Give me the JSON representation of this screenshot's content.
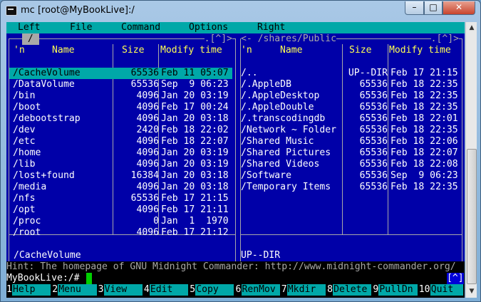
{
  "window": {
    "title": "mc [root@MyBookLive]:/",
    "minimize": "–",
    "maximize": "□",
    "close": "✕"
  },
  "menubar": [
    "Left",
    "File",
    "Command",
    "Options",
    "Right"
  ],
  "left_panel": {
    "path": "/",
    "corner": ".[^]>",
    "headers": {
      "n": "'n",
      "name": "Name",
      "size": "Size",
      "mtime": "Modify time"
    },
    "entries": [
      {
        "name": "/CacheVolume",
        "size": "65536",
        "mtime": "Feb 11 05:07",
        "selected": true
      },
      {
        "name": "/DataVolume",
        "size": "65536",
        "mtime": "Sep  9 06:23"
      },
      {
        "name": "/bin",
        "size": "4096",
        "mtime": "Jan 20 03:19"
      },
      {
        "name": "/boot",
        "size": "4096",
        "mtime": "Feb 17 00:24"
      },
      {
        "name": "/debootstrap",
        "size": "4096",
        "mtime": "Jan 20 03:18"
      },
      {
        "name": "/dev",
        "size": "2420",
        "mtime": "Feb 18 22:02"
      },
      {
        "name": "/etc",
        "size": "4096",
        "mtime": "Feb 18 22:07"
      },
      {
        "name": "/home",
        "size": "4096",
        "mtime": "Jan 20 03:19"
      },
      {
        "name": "/lib",
        "size": "4096",
        "mtime": "Jan 20 03:19"
      },
      {
        "name": "/lost+found",
        "size": "16384",
        "mtime": "Jan 20 03:18"
      },
      {
        "name": "/media",
        "size": "4096",
        "mtime": "Jan 20 03:18"
      },
      {
        "name": "/nfs",
        "size": "65536",
        "mtime": "Feb 17 21:15"
      },
      {
        "name": "/opt",
        "size": "4096",
        "mtime": "Feb 17 21:11"
      },
      {
        "name": "/proc",
        "size": "0",
        "mtime": "Jan  1  1970"
      },
      {
        "name": "/root",
        "size": "4096",
        "mtime": "Feb 17 21:12"
      }
    ],
    "mini_status": "/CacheVolume"
  },
  "right_panel": {
    "path": "<- /shares/Public",
    "corner": ".[^]>",
    "headers": {
      "n": "'n",
      "name": "Name",
      "size": "Size",
      "mtime": "Modify time"
    },
    "entries": [
      {
        "name": "/..",
        "size": "UP--DIR",
        "mtime": "Feb 17 21:15"
      },
      {
        "name": "/.AppleDB",
        "size": "65536",
        "mtime": "Feb 18 22:35"
      },
      {
        "name": "/.AppleDesktop",
        "size": "65536",
        "mtime": "Feb 18 22:35"
      },
      {
        "name": "/.AppleDouble",
        "size": "65536",
        "mtime": "Feb 18 22:35"
      },
      {
        "name": "/.transcodingdb",
        "size": "65536",
        "mtime": "Feb 18 22:01"
      },
      {
        "name": "/Network ~ Folder",
        "size": "65536",
        "mtime": "Feb 18 22:35"
      },
      {
        "name": "/Shared Music",
        "size": "65536",
        "mtime": "Feb 18 22:06"
      },
      {
        "name": "/Shared Pictures",
        "size": "65536",
        "mtime": "Feb 18 22:07"
      },
      {
        "name": "/Shared Videos",
        "size": "65536",
        "mtime": "Feb 18 22:08"
      },
      {
        "name": "/Software",
        "size": "65536",
        "mtime": "Sep  9 06:23"
      },
      {
        "name": "/Temporary Items",
        "size": "65536",
        "mtime": "Feb 18 22:35"
      }
    ],
    "mini_status": "UP--DIR"
  },
  "hint": "Hint: The homepage of GNU Midnight Commander: http://www.midnight-commander.org/",
  "prompt": "MyBookLive:/#",
  "prompt_bracket": "[^]",
  "fkeys": [
    {
      "n": "1",
      "label": "Help"
    },
    {
      "n": "2",
      "label": "Menu"
    },
    {
      "n": "3",
      "label": "View"
    },
    {
      "n": "4",
      "label": "Edit"
    },
    {
      "n": "5",
      "label": "Copy"
    },
    {
      "n": "6",
      "label": "RenMov"
    },
    {
      "n": "7",
      "label": "Mkdir"
    },
    {
      "n": "8",
      "label": "Delete"
    },
    {
      "n": "9",
      "label": "PullDn"
    },
    {
      "n": "10",
      "label": "Quit"
    }
  ],
  "scrollbar": {
    "up": "▲",
    "down": "▼",
    "position": 0.47
  }
}
